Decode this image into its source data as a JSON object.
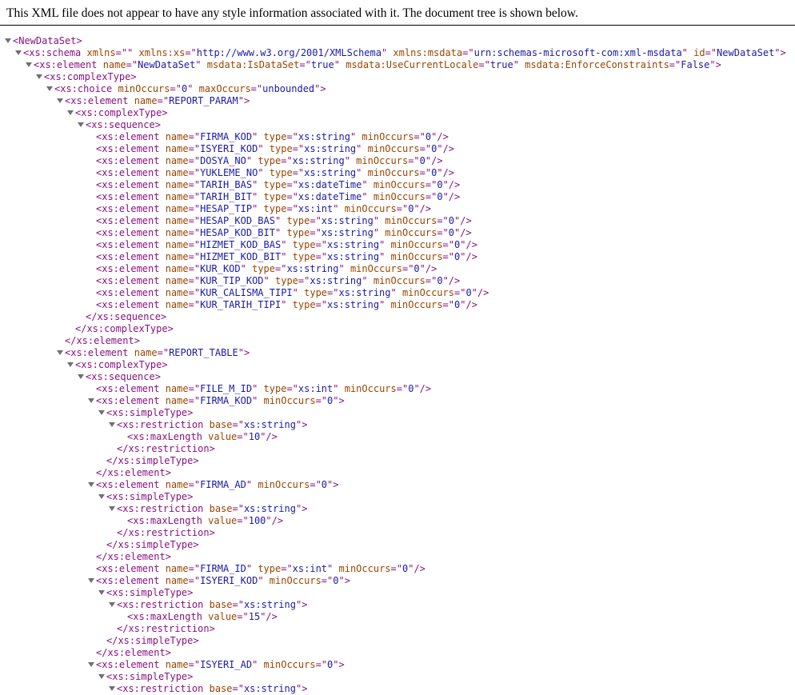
{
  "header": {
    "notice": "This XML file does not appear to have any style information associated with it. The document tree is shown below."
  },
  "colors": {
    "tag": "#881280",
    "attribute_name": "#994500",
    "attribute_value": "#1a1aa6",
    "toggle_arrow": "#707070"
  },
  "lines": [
    {
      "d": 0,
      "c": true,
      "t": "NewDataSet",
      "a": []
    },
    {
      "d": 1,
      "c": true,
      "t": "xs:schema",
      "a": [
        [
          "xmlns",
          ""
        ],
        [
          "xmlns:xs",
          "http://www.w3.org/2001/XMLSchema"
        ],
        [
          "xmlns:msdata",
          "urn:schemas-microsoft-com:xml-msdata"
        ],
        [
          "id",
          "NewDataSet"
        ]
      ]
    },
    {
      "d": 2,
      "c": true,
      "t": "xs:element",
      "a": [
        [
          "name",
          "NewDataSet"
        ],
        [
          "msdata:IsDataSet",
          "true"
        ],
        [
          "msdata:UseCurrentLocale",
          "true"
        ],
        [
          "msdata:EnforceConstraints",
          "False"
        ]
      ]
    },
    {
      "d": 3,
      "c": true,
      "t": "xs:complexType",
      "a": []
    },
    {
      "d": 4,
      "c": true,
      "t": "xs:choice",
      "a": [
        [
          "minOccurs",
          "0"
        ],
        [
          "maxOccurs",
          "unbounded"
        ]
      ]
    },
    {
      "d": 5,
      "c": true,
      "t": "xs:element",
      "a": [
        [
          "name",
          "REPORT_PARAM"
        ]
      ]
    },
    {
      "d": 6,
      "c": true,
      "t": "xs:complexType",
      "a": []
    },
    {
      "d": 7,
      "c": true,
      "t": "xs:sequence",
      "a": []
    },
    {
      "d": 8,
      "s": true,
      "t": "xs:element",
      "a": [
        [
          "name",
          "FIRMA_KOD"
        ],
        [
          "type",
          "xs:string"
        ],
        [
          "minOccurs",
          "0"
        ]
      ]
    },
    {
      "d": 8,
      "s": true,
      "t": "xs:element",
      "a": [
        [
          "name",
          "ISYERI_KOD"
        ],
        [
          "type",
          "xs:string"
        ],
        [
          "minOccurs",
          "0"
        ]
      ]
    },
    {
      "d": 8,
      "s": true,
      "t": "xs:element",
      "a": [
        [
          "name",
          "DOSYA_NO"
        ],
        [
          "type",
          "xs:string"
        ],
        [
          "minOccurs",
          "0"
        ]
      ]
    },
    {
      "d": 8,
      "s": true,
      "t": "xs:element",
      "a": [
        [
          "name",
          "YUKLEME_NO"
        ],
        [
          "type",
          "xs:string"
        ],
        [
          "minOccurs",
          "0"
        ]
      ]
    },
    {
      "d": 8,
      "s": true,
      "t": "xs:element",
      "a": [
        [
          "name",
          "TARIH_BAS"
        ],
        [
          "type",
          "xs:dateTime"
        ],
        [
          "minOccurs",
          "0"
        ]
      ]
    },
    {
      "d": 8,
      "s": true,
      "t": "xs:element",
      "a": [
        [
          "name",
          "TARIH_BIT"
        ],
        [
          "type",
          "xs:dateTime"
        ],
        [
          "minOccurs",
          "0"
        ]
      ]
    },
    {
      "d": 8,
      "s": true,
      "t": "xs:element",
      "a": [
        [
          "name",
          "HESAP_TIP"
        ],
        [
          "type",
          "xs:int"
        ],
        [
          "minOccurs",
          "0"
        ]
      ]
    },
    {
      "d": 8,
      "s": true,
      "t": "xs:element",
      "a": [
        [
          "name",
          "HESAP_KOD_BAS"
        ],
        [
          "type",
          "xs:string"
        ],
        [
          "minOccurs",
          "0"
        ]
      ]
    },
    {
      "d": 8,
      "s": true,
      "t": "xs:element",
      "a": [
        [
          "name",
          "HESAP_KOD_BIT"
        ],
        [
          "type",
          "xs:string"
        ],
        [
          "minOccurs",
          "0"
        ]
      ]
    },
    {
      "d": 8,
      "s": true,
      "t": "xs:element",
      "a": [
        [
          "name",
          "HIZMET_KOD_BAS"
        ],
        [
          "type",
          "xs:string"
        ],
        [
          "minOccurs",
          "0"
        ]
      ]
    },
    {
      "d": 8,
      "s": true,
      "t": "xs:element",
      "a": [
        [
          "name",
          "HIZMET_KOD_BIT"
        ],
        [
          "type",
          "xs:string"
        ],
        [
          "minOccurs",
          "0"
        ]
      ]
    },
    {
      "d": 8,
      "s": true,
      "t": "xs:element",
      "a": [
        [
          "name",
          "KUR_KOD"
        ],
        [
          "type",
          "xs:string"
        ],
        [
          "minOccurs",
          "0"
        ]
      ]
    },
    {
      "d": 8,
      "s": true,
      "t": "xs:element",
      "a": [
        [
          "name",
          "KUR_TIP_KOD"
        ],
        [
          "type",
          "xs:string"
        ],
        [
          "minOccurs",
          "0"
        ]
      ]
    },
    {
      "d": 8,
      "s": true,
      "t": "xs:element",
      "a": [
        [
          "name",
          "KUR_CALISMA_TIPI"
        ],
        [
          "type",
          "xs:string"
        ],
        [
          "minOccurs",
          "0"
        ]
      ]
    },
    {
      "d": 8,
      "s": true,
      "t": "xs:element",
      "a": [
        [
          "name",
          "KUR_TARIH_TIPI"
        ],
        [
          "type",
          "xs:string"
        ],
        [
          "minOccurs",
          "0"
        ]
      ]
    },
    {
      "d": 7,
      "e": true,
      "t": "xs:sequence"
    },
    {
      "d": 6,
      "e": true,
      "t": "xs:complexType"
    },
    {
      "d": 5,
      "e": true,
      "t": "xs:element"
    },
    {
      "d": 5,
      "c": true,
      "t": "xs:element",
      "a": [
        [
          "name",
          "REPORT_TABLE"
        ]
      ]
    },
    {
      "d": 6,
      "c": true,
      "t": "xs:complexType",
      "a": []
    },
    {
      "d": 7,
      "c": true,
      "t": "xs:sequence",
      "a": []
    },
    {
      "d": 8,
      "s": true,
      "t": "xs:element",
      "a": [
        [
          "name",
          "FILE_M_ID"
        ],
        [
          "type",
          "xs:int"
        ],
        [
          "minOccurs",
          "0"
        ]
      ]
    },
    {
      "d": 8,
      "c": true,
      "t": "xs:element",
      "a": [
        [
          "name",
          "FIRMA_KOD"
        ],
        [
          "minOccurs",
          "0"
        ]
      ]
    },
    {
      "d": 9,
      "c": true,
      "t": "xs:simpleType",
      "a": []
    },
    {
      "d": 10,
      "c": true,
      "t": "xs:restriction",
      "a": [
        [
          "base",
          "xs:string"
        ]
      ]
    },
    {
      "d": 11,
      "s": true,
      "t": "xs:maxLength",
      "a": [
        [
          "value",
          "10"
        ]
      ]
    },
    {
      "d": 10,
      "e": true,
      "t": "xs:restriction"
    },
    {
      "d": 9,
      "e": true,
      "t": "xs:simpleType"
    },
    {
      "d": 8,
      "e": true,
      "t": "xs:element"
    },
    {
      "d": 8,
      "c": true,
      "t": "xs:element",
      "a": [
        [
          "name",
          "FIRMA_AD"
        ],
        [
          "minOccurs",
          "0"
        ]
      ]
    },
    {
      "d": 9,
      "c": true,
      "t": "xs:simpleType",
      "a": []
    },
    {
      "d": 10,
      "c": true,
      "t": "xs:restriction",
      "a": [
        [
          "base",
          "xs:string"
        ]
      ]
    },
    {
      "d": 11,
      "s": true,
      "t": "xs:maxLength",
      "a": [
        [
          "value",
          "100"
        ]
      ]
    },
    {
      "d": 10,
      "e": true,
      "t": "xs:restriction"
    },
    {
      "d": 9,
      "e": true,
      "t": "xs:simpleType"
    },
    {
      "d": 8,
      "e": true,
      "t": "xs:element"
    },
    {
      "d": 8,
      "s": true,
      "t": "xs:element",
      "a": [
        [
          "name",
          "FIRMA_ID"
        ],
        [
          "type",
          "xs:int"
        ],
        [
          "minOccurs",
          "0"
        ]
      ]
    },
    {
      "d": 8,
      "c": true,
      "t": "xs:element",
      "a": [
        [
          "name",
          "ISYERI_KOD"
        ],
        [
          "minOccurs",
          "0"
        ]
      ]
    },
    {
      "d": 9,
      "c": true,
      "t": "xs:simpleType",
      "a": []
    },
    {
      "d": 10,
      "c": true,
      "t": "xs:restriction",
      "a": [
        [
          "base",
          "xs:string"
        ]
      ]
    },
    {
      "d": 11,
      "s": true,
      "t": "xs:maxLength",
      "a": [
        [
          "value",
          "15"
        ]
      ]
    },
    {
      "d": 10,
      "e": true,
      "t": "xs:restriction"
    },
    {
      "d": 9,
      "e": true,
      "t": "xs:simpleType"
    },
    {
      "d": 8,
      "e": true,
      "t": "xs:element"
    },
    {
      "d": 8,
      "c": true,
      "t": "xs:element",
      "a": [
        [
          "name",
          "ISYERI_AD"
        ],
        [
          "minOccurs",
          "0"
        ]
      ]
    },
    {
      "d": 9,
      "c": true,
      "t": "xs:simpleType",
      "a": []
    },
    {
      "d": 10,
      "c": true,
      "t": "xs:restriction",
      "a": [
        [
          "base",
          "xs:string"
        ]
      ]
    }
  ]
}
